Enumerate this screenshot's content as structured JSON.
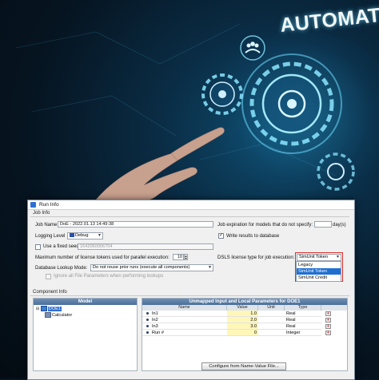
{
  "hero": {
    "headline": "AUTOMATION"
  },
  "window": {
    "title": "Run Info"
  },
  "job_info": {
    "section_label": "Job Info",
    "job_name_label": "Job Name",
    "job_name_value": "DoE - 2022.01.13 14:49:38",
    "logging_level_label": "Logging Level",
    "logging_level_value": "Debug",
    "use_fixed_seed_label": "Use a fixed seed",
    "seed_value": "1642060006704",
    "max_tokens_label": "Maximum number of license tokens used for parallel execution:",
    "max_tokens_value": "10",
    "db_lookup_label": "Database Lookup Mode:",
    "db_lookup_value": "Do not reuse prior runs (execute all components)",
    "ignore_params_label": "Ignore all File Parameters when performing lookups",
    "expiration_label": "Job expiration for models that do not specify:",
    "expiration_unit": "day(s)",
    "write_results_label": "Write results to database",
    "dsls_label": "DSLS license type for job execution:",
    "dsls_value": "SimUnit Token",
    "dsls_options": [
      "Legacy",
      "SimUnit Token",
      "SimUnit Credit"
    ]
  },
  "component_info": {
    "section_label": "Component Info",
    "model_header": "Model",
    "tree": [
      "DOE1",
      "Calculator"
    ],
    "params_header": "Unmapped Input and Local Parameters for DOE1",
    "columns": [
      "Name",
      "Value",
      "Unit",
      "Type"
    ],
    "rows": [
      {
        "name": "In1",
        "value": "1.0",
        "unit": "",
        "type": "Real"
      },
      {
        "name": "In2",
        "value": "2.0",
        "unit": "",
        "type": "Real"
      },
      {
        "name": "In3",
        "value": "3.0",
        "unit": "",
        "type": "Real"
      },
      {
        "name": "Run #",
        "value": "0",
        "unit": "",
        "type": "Integer"
      }
    ],
    "configure_button": "Configure from Name-Value File..."
  },
  "colors": {
    "accent": "#1f6fd1",
    "highlight_border": "#d8302c",
    "value_cell": "#fff7b8",
    "pane_header": "#4b6f99"
  }
}
